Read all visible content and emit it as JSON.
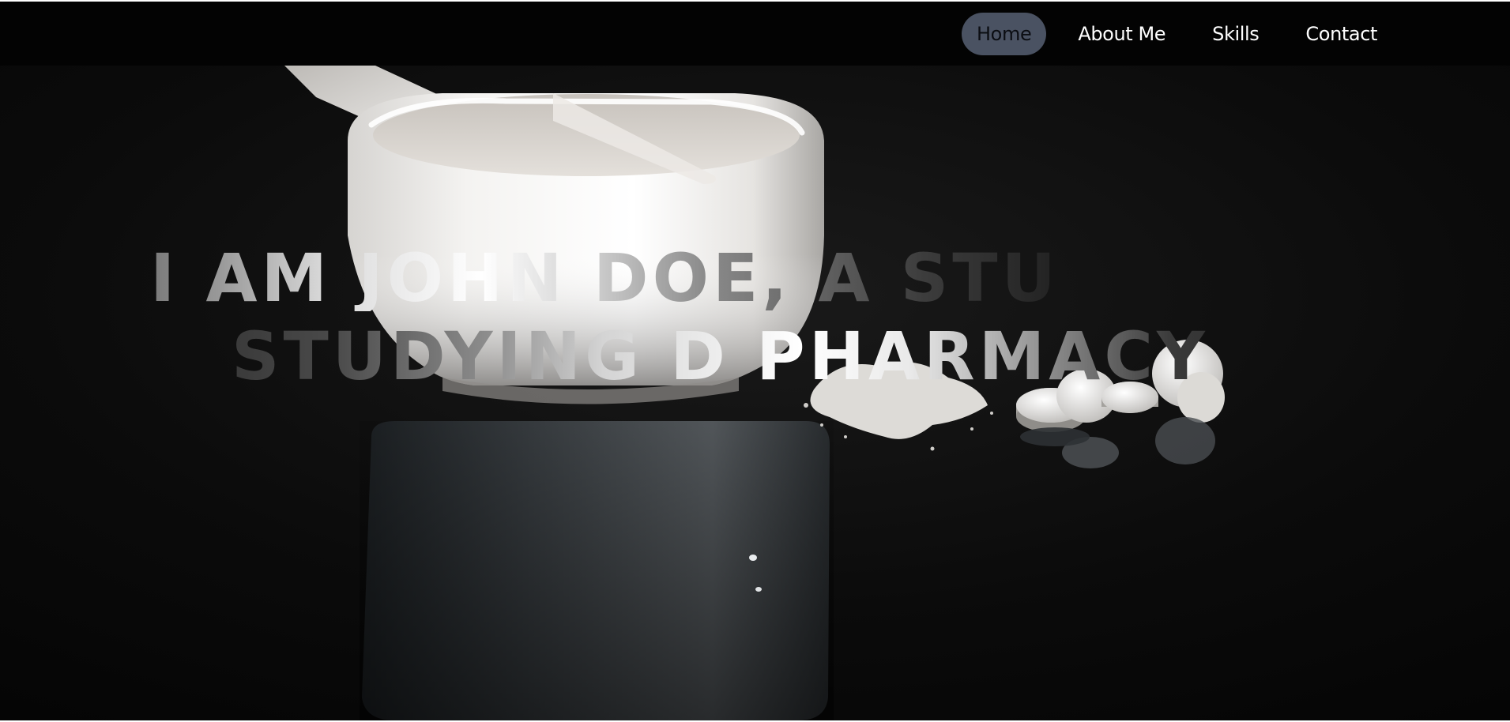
{
  "nav": {
    "items": [
      {
        "label": "Home",
        "active": true
      },
      {
        "label": "About Me",
        "active": false
      },
      {
        "label": "Skills",
        "active": false
      },
      {
        "label": "Contact",
        "active": false
      }
    ]
  },
  "hero": {
    "headline_line1": "I AM JOHN DOE, A STU",
    "headline_line2": "STUDYING D PHARMACY",
    "image_subject": "mortar-pestle-and-pills-photo"
  },
  "colors": {
    "navbar_bg": "#030303",
    "active_pill": "#4a5262",
    "hero_bg": "#060606",
    "nav_text": "#ffffff"
  }
}
